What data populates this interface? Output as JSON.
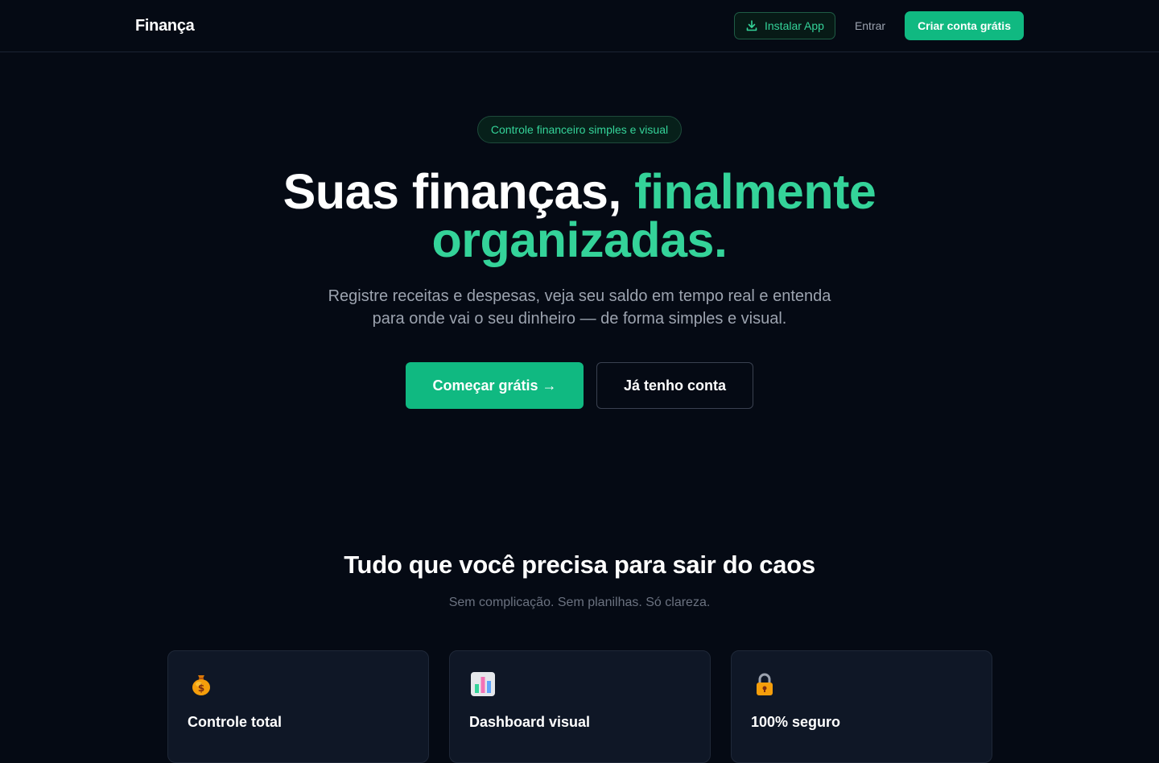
{
  "nav": {
    "brand": "Finança",
    "install_label": "Instalar App",
    "login_label": "Entrar",
    "signup_label": "Criar conta grátis"
  },
  "hero": {
    "badge": "Controle financeiro simples e visual",
    "headline_part1": "Suas finanças, ",
    "headline_accent_line1": "finalmente",
    "headline_accent_line2": "organizadas.",
    "subtitle_line1": "Registre receitas e despesas, veja seu saldo em tempo real e entenda",
    "subtitle_line2": "para onde vai o seu dinheiro — de forma simples e visual.",
    "primary_cta": "Começar grátis →",
    "secondary_cta": "Já tenho conta"
  },
  "features": {
    "title": "Tudo que você precisa para sair do caos",
    "subtitle": "Sem complicação. Sem planilhas. Só clareza.",
    "cards": [
      {
        "icon": "money-bag-icon",
        "title": "Controle total"
      },
      {
        "icon": "bar-chart-icon",
        "title": "Dashboard visual"
      },
      {
        "icon": "lock-icon",
        "title": "100% seguro"
      }
    ]
  },
  "colors": {
    "background": "#050a14",
    "accent": "#10b981",
    "accent_text": "#34d399",
    "muted_text": "#9ca3af",
    "card_bg": "#0f1726"
  }
}
